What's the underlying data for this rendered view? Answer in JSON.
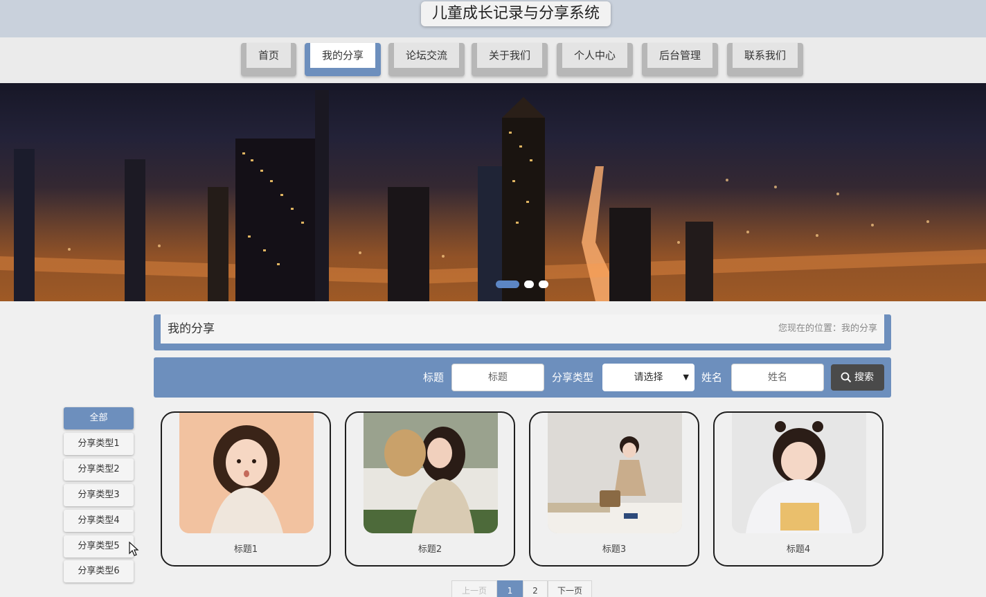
{
  "header": {
    "title": "儿童成长记录与分享系统"
  },
  "nav": {
    "items": [
      {
        "label": "首页"
      },
      {
        "label": "我的分享"
      },
      {
        "label": "论坛交流"
      },
      {
        "label": "关于我们"
      },
      {
        "label": "个人中心"
      },
      {
        "label": "后台管理"
      },
      {
        "label": "联系我们"
      }
    ],
    "active_item": "我的分享"
  },
  "banner": {
    "slide_count": 3,
    "active_slide": 1
  },
  "breadcrumb": {
    "title": "我的分享",
    "location": "您现在的位置：我的分享"
  },
  "search": {
    "title_label": "标题",
    "title_placeholder": "标题",
    "type_label": "分享类型",
    "type_selected": "请选择",
    "name_label": "姓名",
    "name_placeholder": "姓名",
    "button_label": "搜索"
  },
  "sidebar": {
    "items": [
      {
        "label": "全部"
      },
      {
        "label": "分享类型1"
      },
      {
        "label": "分享类型2"
      },
      {
        "label": "分享类型3"
      },
      {
        "label": "分享类型4"
      },
      {
        "label": "分享类型5"
      },
      {
        "label": "分享类型6"
      }
    ],
    "active_item": "全部"
  },
  "cards": [
    {
      "caption": "标题1"
    },
    {
      "caption": "标题2"
    },
    {
      "caption": "标题3"
    },
    {
      "caption": "标题4"
    }
  ],
  "pagination": {
    "prev": "上一页",
    "pages": [
      "1",
      "2"
    ],
    "next": "下一页",
    "current": "1"
  },
  "colors": {
    "accent": "#6d8fbd",
    "header_bg": "#c9d1dc",
    "search_button": "#4a4a4a"
  }
}
